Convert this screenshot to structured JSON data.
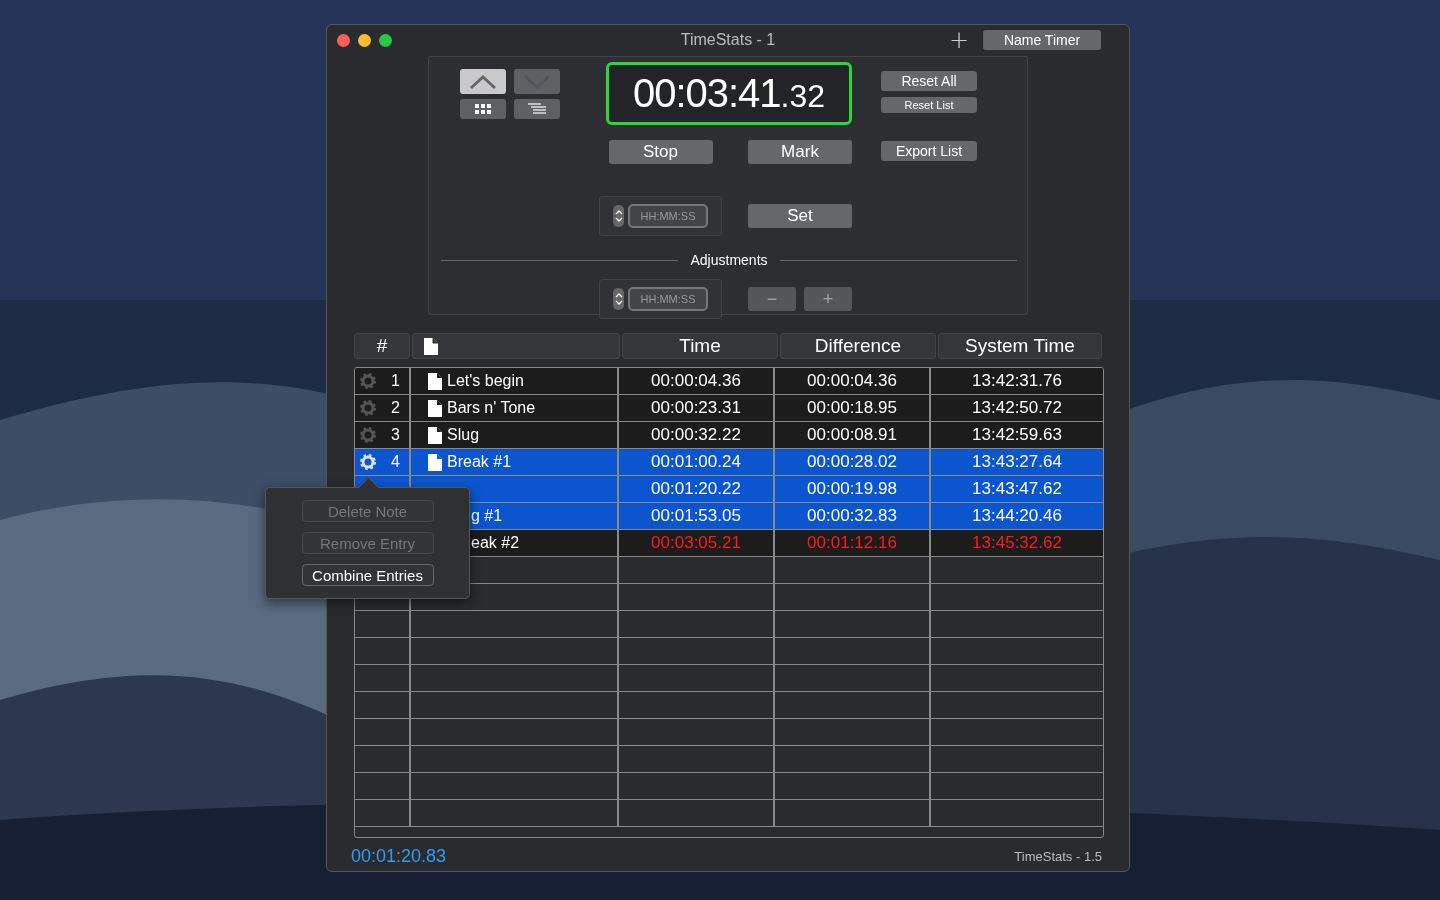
{
  "window": {
    "title": "TimeStats - 1",
    "add_label": "+",
    "name_button": "Name Timer"
  },
  "panel": {
    "arrows": [
      {
        "kind": "up",
        "selected": true
      },
      {
        "kind": "down",
        "selected": false
      }
    ],
    "views": [
      {
        "kind": "grid",
        "selected": false
      },
      {
        "kind": "list",
        "selected": false
      }
    ],
    "timer": {
      "main": "00:03:41",
      "fraction": ".32",
      "running": true
    },
    "reset_all": "Reset All",
    "reset_list": "Reset List",
    "export": "Export List",
    "stop": "Stop",
    "mark": "Mark",
    "set": "Set",
    "set_field": {
      "placeholder": "HH:MM:SS"
    },
    "adjustments_label": "Adjustments",
    "adjust_field": {
      "placeholder": "HH:MM:SS"
    },
    "adjust_buttons": [
      {
        "label": "−",
        "disabled": true
      },
      {
        "label": "+",
        "disabled": true
      }
    ]
  },
  "table": {
    "columns": [
      {
        "kind": "text",
        "label": "#"
      },
      {
        "kind": "icon"
      },
      {
        "kind": "text",
        "label": "Time"
      },
      {
        "kind": "text",
        "label": "Difference"
      },
      {
        "kind": "text",
        "label": "System Time"
      }
    ],
    "rows": [
      {
        "number": "1",
        "note": "Let's begin",
        "time": "00:00:04.36",
        "difference": "00:00:04.36",
        "system_time": "13:42:31.76",
        "selected": false,
        "over": false
      },
      {
        "number": "2",
        "note": "Bars n' Tone",
        "time": "00:00:23.31",
        "difference": "00:00:18.95",
        "system_time": "13:42:50.72",
        "selected": false,
        "over": false
      },
      {
        "number": "3",
        "note": "Slug",
        "time": "00:00:32.22",
        "difference": "00:00:08.91",
        "system_time": "13:42:59.63",
        "selected": false,
        "over": false
      },
      {
        "number": "4",
        "note": "Break #1",
        "time": "00:01:00.24",
        "difference": "00:00:28.02",
        "system_time": "13:43:27.64",
        "selected": true,
        "over": false
      },
      {
        "time": "00:01:20.22",
        "difference": "00:00:19.98",
        "system_time": "13:43:47.62",
        "selected": true,
        "over": false
      },
      {
        "note": "g #1",
        "time": "00:01:53.05",
        "difference": "00:00:32.83",
        "system_time": "13:44:20.46",
        "selected": true,
        "over": false
      },
      {
        "note": "eak #2",
        "time": "00:03:05.21",
        "difference": "00:01:12.16",
        "system_time": "13:45:32.62",
        "selected": false,
        "over": true
      }
    ]
  },
  "popover": {
    "items": [
      {
        "label": "Delete Note",
        "disabled": true
      },
      {
        "label": "Remove Entry",
        "disabled": true
      },
      {
        "label": "Combine Entries",
        "disabled": false
      }
    ]
  },
  "footer": {
    "total": "00:01:20.83",
    "version": "TimeStats - 1.5"
  }
}
